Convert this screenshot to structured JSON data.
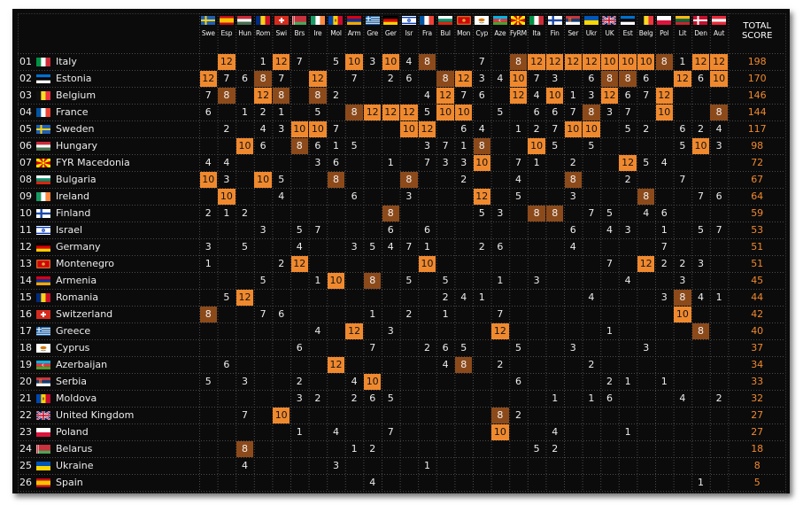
{
  "table": {
    "total_label_1": "TOTAL",
    "total_label_2": "SCORE",
    "voters": [
      {
        "label": "Swe",
        "flag": "se"
      },
      {
        "label": "Esp",
        "flag": "es"
      },
      {
        "label": "Hun",
        "flag": "hu"
      },
      {
        "label": "Rom",
        "flag": "ro"
      },
      {
        "label": "Swi",
        "flag": "ch"
      },
      {
        "label": "Brs",
        "flag": "by"
      },
      {
        "label": "Ire",
        "flag": "ie"
      },
      {
        "label": "Mol",
        "flag": "md"
      },
      {
        "label": "Arm",
        "flag": "am"
      },
      {
        "label": "Gre",
        "flag": "gr"
      },
      {
        "label": "Ger",
        "flag": "de"
      },
      {
        "label": "Isr",
        "flag": "il"
      },
      {
        "label": "Fra",
        "flag": "fr"
      },
      {
        "label": "Bul",
        "flag": "bg"
      },
      {
        "label": "Mon",
        "flag": "me"
      },
      {
        "label": "Cyp",
        "flag": "cy"
      },
      {
        "label": "Aze",
        "flag": "az"
      },
      {
        "label": "FyRM",
        "flag": "mk"
      },
      {
        "label": "Ita",
        "flag": "it"
      },
      {
        "label": "Fin",
        "flag": "fi"
      },
      {
        "label": "Ser",
        "flag": "rs"
      },
      {
        "label": "Ukr",
        "flag": "ua"
      },
      {
        "label": "UK",
        "flag": "gb"
      },
      {
        "label": "Est",
        "flag": "ee"
      },
      {
        "label": "Belg",
        "flag": "be"
      },
      {
        "label": "Pol",
        "flag": "pl"
      },
      {
        "label": "Lit",
        "flag": "lt"
      },
      {
        "label": "Den",
        "flag": "dk"
      },
      {
        "label": "Aut",
        "flag": "at"
      }
    ],
    "rows": [
      {
        "pos": "01",
        "country": "Italy",
        "flag": "it",
        "total": "198",
        "scores": [
          "",
          "12",
          "",
          "1",
          "12",
          "7",
          "",
          "5",
          "10",
          "3",
          "10",
          "4",
          "8",
          "",
          "",
          "7",
          "",
          "8",
          "12",
          "12",
          "12",
          "12",
          "10",
          "10",
          "10",
          "8",
          "1",
          "12",
          "12"
        ]
      },
      {
        "pos": "02",
        "country": "Estonia",
        "flag": "ee",
        "total": "170",
        "scores": [
          "12",
          "7",
          "6",
          "8",
          "7",
          "",
          "12",
          "",
          "7",
          "",
          "2",
          "6",
          "",
          "8",
          "12",
          "3",
          "4",
          "10",
          "7",
          "3",
          "",
          "6",
          "8",
          "8",
          "6",
          "",
          "12",
          "6",
          "10"
        ]
      },
      {
        "pos": "03",
        "country": "Belgium",
        "flag": "be",
        "total": "146",
        "scores": [
          "7",
          "8",
          "",
          "12",
          "8",
          "",
          "8",
          "2",
          "",
          "",
          "",
          "",
          "4",
          "12",
          "7",
          "6",
          "",
          "12",
          "4",
          "10",
          "1",
          "3",
          "12",
          "6",
          "7",
          "12",
          "",
          "",
          ""
        ]
      },
      {
        "pos": "04",
        "country": "France",
        "flag": "fr",
        "total": "144",
        "scores": [
          "6",
          "",
          "1",
          "2",
          "1",
          "",
          "5",
          "",
          "8",
          "12",
          "12",
          "12",
          "5",
          "10",
          "10",
          "",
          "5",
          "",
          "6",
          "6",
          "7",
          "8",
          "3",
          "7",
          "",
          "10",
          "",
          "",
          "8"
        ]
      },
      {
        "pos": "05",
        "country": "Sweden",
        "flag": "se",
        "total": "117",
        "scores": [
          "",
          "2",
          "",
          "4",
          "3",
          "10",
          "10",
          "7",
          "",
          "",
          "",
          "10",
          "12",
          "",
          "6",
          "4",
          "",
          "1",
          "2",
          "7",
          "10",
          "10",
          "",
          "5",
          "2",
          "",
          "6",
          "2",
          "4"
        ]
      },
      {
        "pos": "06",
        "country": "Hungary",
        "flag": "hu",
        "total": "98",
        "scores": [
          "",
          "",
          "10",
          "6",
          "",
          "8",
          "6",
          "1",
          "5",
          "",
          "",
          "",
          "3",
          "7",
          "1",
          "8",
          "",
          "",
          "10",
          "5",
          "",
          "5",
          "",
          "",
          "",
          "",
          "5",
          "10",
          "3"
        ]
      },
      {
        "pos": "07",
        "country": "FYR Macedonia",
        "flag": "mk",
        "total": "72",
        "scores": [
          "4",
          "4",
          "",
          "",
          "",
          "",
          "3",
          "6",
          "",
          "",
          "1",
          "",
          "7",
          "3",
          "3",
          "10",
          "",
          "7",
          "1",
          "",
          "2",
          "",
          "",
          "12",
          "5",
          "4",
          "",
          "",
          ""
        ]
      },
      {
        "pos": "08",
        "country": "Bulgaria",
        "flag": "bg",
        "total": "67",
        "scores": [
          "10",
          "3",
          "",
          "10",
          "5",
          "",
          "",
          "8",
          "",
          "",
          "",
          "8",
          "",
          "",
          "2",
          "",
          "",
          "4",
          "",
          "",
          "8",
          "",
          "",
          "2",
          "",
          "",
          "7",
          "",
          ""
        ]
      },
      {
        "pos": "09",
        "country": "Ireland",
        "flag": "ie",
        "total": "64",
        "scores": [
          "",
          "10",
          "",
          "",
          "4",
          "",
          "",
          "",
          "6",
          "",
          "",
          "3",
          "",
          "",
          "",
          "12",
          "",
          "5",
          "",
          "",
          "3",
          "",
          "",
          "",
          "8",
          "",
          "",
          "7",
          "6"
        ]
      },
      {
        "pos": "10",
        "country": "Finland",
        "flag": "fi",
        "total": "59",
        "scores": [
          "2",
          "1",
          "2",
          "",
          "",
          "",
          "",
          "",
          "",
          "",
          "8",
          "",
          "",
          "",
          "",
          "5",
          "3",
          "",
          "8",
          "8",
          "",
          "7",
          "5",
          "",
          "4",
          "6",
          "",
          "",
          ""
        ]
      },
      {
        "pos": "11",
        "country": "Israel",
        "flag": "il",
        "total": "53",
        "scores": [
          "",
          "",
          "",
          "3",
          "",
          "5",
          "7",
          "",
          "",
          "",
          "6",
          "",
          "6",
          "",
          "",
          "",
          "",
          "",
          "",
          "",
          "6",
          "",
          "4",
          "3",
          "",
          "1",
          "",
          "5",
          "7"
        ]
      },
      {
        "pos": "12",
        "country": "Germany",
        "flag": "de",
        "total": "51",
        "scores": [
          "3",
          "",
          "5",
          "",
          "",
          "4",
          "",
          "",
          "3",
          "5",
          "4",
          "7",
          "1",
          "",
          "",
          "2",
          "6",
          "",
          "",
          "",
          "4",
          "",
          "",
          "",
          "",
          "7",
          "",
          "",
          ""
        ]
      },
      {
        "pos": "13",
        "country": "Montenegro",
        "flag": "me",
        "total": "51",
        "scores": [
          "1",
          "",
          "",
          "",
          "2",
          "12",
          "",
          "",
          "",
          "",
          "",
          "",
          "10",
          "",
          "",
          "",
          "",
          "",
          "",
          "",
          "",
          "",
          "7",
          "",
          "12",
          "2",
          "2",
          "3",
          ""
        ]
      },
      {
        "pos": "14",
        "country": "Armenia",
        "flag": "am",
        "total": "45",
        "scores": [
          "",
          "",
          "",
          "5",
          "",
          "",
          "1",
          "10",
          "",
          "8",
          "",
          "5",
          "",
          "5",
          "",
          "",
          "1",
          "",
          "3",
          "",
          "",
          "",
          "",
          "4",
          "",
          "",
          "3",
          "",
          ""
        ]
      },
      {
        "pos": "15",
        "country": "Romania",
        "flag": "ro",
        "total": "44",
        "scores": [
          "",
          "5",
          "12",
          "",
          "",
          "",
          "",
          "",
          "",
          "",
          "",
          "",
          "",
          "2",
          "4",
          "1",
          "",
          "",
          "",
          "",
          "",
          "4",
          "",
          "",
          "",
          "3",
          "8",
          "4",
          "1"
        ]
      },
      {
        "pos": "16",
        "country": "Switzerland",
        "flag": "ch",
        "total": "42",
        "scores": [
          "8",
          "",
          "",
          "7",
          "6",
          "",
          "",
          "",
          "",
          "1",
          "",
          "2",
          "",
          "1",
          "",
          "",
          "7",
          "",
          "",
          "",
          "",
          "",
          "",
          "",
          "",
          "",
          "10",
          "",
          ""
        ]
      },
      {
        "pos": "17",
        "country": "Greece",
        "flag": "gr",
        "total": "40",
        "scores": [
          "",
          "",
          "",
          "",
          "",
          "",
          "4",
          "",
          "12",
          "",
          "3",
          "",
          "",
          "",
          "",
          "",
          "12",
          "",
          "",
          "",
          "",
          "",
          "1",
          "",
          "",
          "",
          "",
          "8",
          ""
        ]
      },
      {
        "pos": "18",
        "country": "Cyprus",
        "flag": "cy",
        "total": "37",
        "scores": [
          "",
          "",
          "",
          "",
          "",
          "6",
          "",
          "",
          "",
          "7",
          "",
          "",
          "2",
          "6",
          "5",
          "",
          "",
          "5",
          "",
          "",
          "3",
          "",
          "",
          "",
          "3",
          "",
          "",
          "",
          ""
        ]
      },
      {
        "pos": "19",
        "country": "Azerbaijan",
        "flag": "az",
        "total": "34",
        "scores": [
          "",
          "6",
          "",
          "",
          "",
          "",
          "",
          "12",
          "",
          "",
          "",
          "",
          "",
          "4",
          "8",
          "",
          "2",
          "",
          "",
          "",
          "",
          "2",
          "",
          "",
          "",
          "",
          "",
          "",
          ""
        ]
      },
      {
        "pos": "20",
        "country": "Serbia",
        "flag": "rs",
        "total": "33",
        "scores": [
          "5",
          "",
          "3",
          "",
          "",
          "2",
          "",
          "",
          "4",
          "10",
          "",
          "",
          "",
          "",
          "",
          "",
          "",
          "6",
          "",
          "",
          "",
          "",
          "2",
          "1",
          "",
          "1",
          "",
          "",
          ""
        ]
      },
      {
        "pos": "21",
        "country": "Moldova",
        "flag": "md",
        "total": "32",
        "scores": [
          "",
          "",
          "",
          "",
          "",
          "3",
          "2",
          "",
          "2",
          "6",
          "5",
          "",
          "",
          "",
          "",
          "",
          "",
          "",
          "",
          "1",
          "",
          "1",
          "6",
          "",
          "",
          "",
          "4",
          "",
          "2"
        ]
      },
      {
        "pos": "22",
        "country": "United Kingdom",
        "flag": "gb",
        "total": "27",
        "scores": [
          "",
          "",
          "7",
          "",
          "10",
          "",
          "",
          "",
          "",
          "",
          "",
          "",
          "",
          "",
          "",
          "",
          "8",
          "2",
          "",
          "",
          "",
          "",
          "",
          "",
          "",
          "",
          "",
          "",
          ""
        ]
      },
      {
        "pos": "23",
        "country": "Poland",
        "flag": "pl",
        "total": "27",
        "scores": [
          "",
          "",
          "",
          "",
          "",
          "1",
          "",
          "4",
          "",
          "",
          "7",
          "",
          "",
          "",
          "",
          "",
          "10",
          "",
          "",
          "4",
          "",
          "",
          "",
          "1",
          "",
          "",
          "",
          "",
          ""
        ]
      },
      {
        "pos": "24",
        "country": "Belarus",
        "flag": "by",
        "total": "18",
        "scores": [
          "",
          "",
          "8",
          "",
          "",
          "",
          "",
          "",
          "1",
          "2",
          "",
          "",
          "",
          "",
          "",
          "",
          "",
          "",
          "5",
          "2",
          "",
          "",
          "",
          "",
          "",
          "",
          "",
          "",
          ""
        ]
      },
      {
        "pos": "25",
        "country": "Ukraine",
        "flag": "ua",
        "total": "8",
        "scores": [
          "",
          "",
          "4",
          "",
          "",
          "",
          "",
          "3",
          "",
          "",
          "",
          "",
          "1",
          "",
          "",
          "",
          "",
          "",
          "",
          "",
          "",
          "",
          "",
          "",
          "",
          "",
          "",
          "",
          ""
        ]
      },
      {
        "pos": "26",
        "country": "Spain",
        "flag": "es",
        "total": "5",
        "scores": [
          "",
          "",
          "",
          "",
          "",
          "",
          "",
          "",
          "",
          "4",
          "",
          "",
          "",
          "",
          "",
          "",
          "",
          "",
          "",
          "",
          "",
          "",
          "",
          "",
          "",
          "",
          "",
          "1",
          ""
        ]
      }
    ],
    "colors": {
      "background": "#0b0b0b",
      "twelve": "#f0892e",
      "eight": "#8c4a1b",
      "total_text": "#f0892e",
      "text": "#ececec"
    }
  }
}
